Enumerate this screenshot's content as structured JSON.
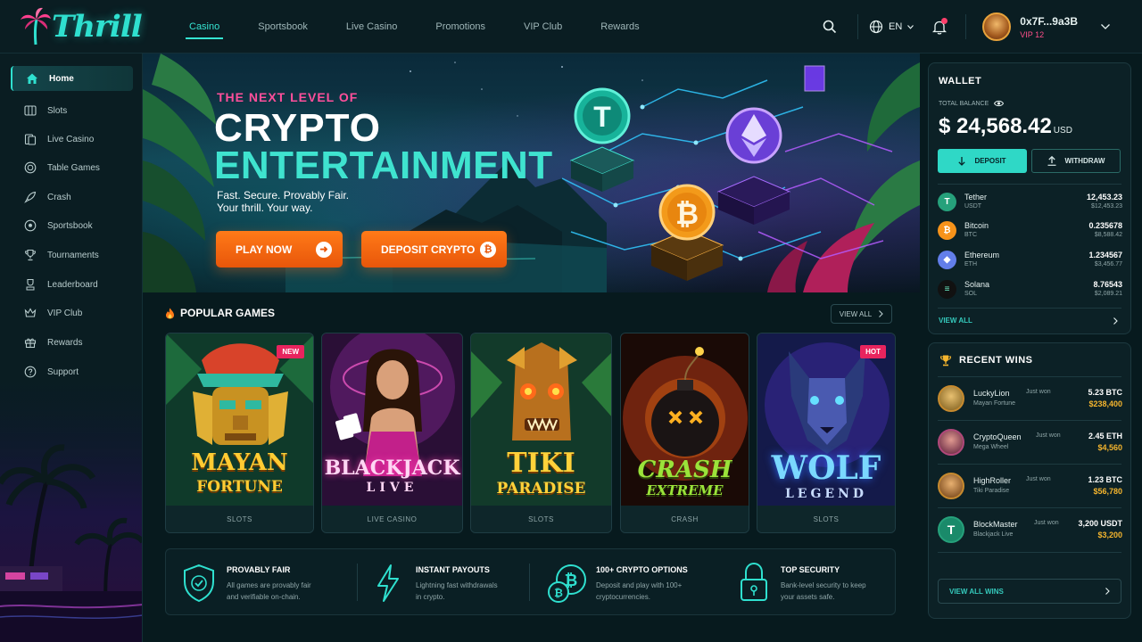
{
  "brand": {
    "name": "Thrill"
  },
  "nav": {
    "items": [
      {
        "label": "Casino",
        "active": true
      },
      {
        "label": "Sportsbook"
      },
      {
        "label": "Live Casino"
      },
      {
        "label": "Promotions"
      },
      {
        "label": "VIP Club"
      },
      {
        "label": "Rewards"
      }
    ],
    "language": "EN",
    "user": {
      "name": "0x7F...9a3B",
      "tier": "VIP 12"
    }
  },
  "sidebar": {
    "items": [
      {
        "label": "Home",
        "icon": "home-icon",
        "active": true
      },
      {
        "label": "Slots",
        "icon": "slots-icon"
      },
      {
        "label": "Live Casino",
        "icon": "live-casino-icon"
      },
      {
        "label": "Table Games",
        "icon": "table-games-icon"
      },
      {
        "label": "Crash",
        "icon": "rocket-icon"
      },
      {
        "label": "Sportsbook",
        "icon": "soccer-ball-icon"
      },
      {
        "label": "Tournaments",
        "icon": "trophy-icon"
      },
      {
        "label": "Leaderboard",
        "icon": "leaderboard-icon"
      },
      {
        "label": "VIP Club",
        "icon": "crown-icon"
      },
      {
        "label": "Rewards",
        "icon": "gift-icon"
      },
      {
        "label": "Support",
        "icon": "help-icon"
      }
    ]
  },
  "hero": {
    "kicker": "THE NEXT LEVEL OF",
    "title_line1": "CRYPTO",
    "title_line2": "ENTERTAINMENT",
    "sub_line1": "Fast. Secure. Provably Fair.",
    "sub_line2": "Your thrill. Your way.",
    "cta_primary": "PLAY NOW",
    "cta_secondary": "DEPOSIT CRYPTO"
  },
  "popular": {
    "title": "POPULAR GAMES",
    "view_all": "VIEW ALL",
    "games": [
      {
        "title": "MAYAN",
        "subtitle": "FORTUNE",
        "category": "SLOTS",
        "badge": "NEW"
      },
      {
        "title": "BLACKJACK",
        "subtitle": "LIVE",
        "category": "LIVE CASINO",
        "badge": ""
      },
      {
        "title": "TIKI",
        "subtitle": "PARADISE",
        "category": "SLOTS",
        "badge": ""
      },
      {
        "title": "CRASH",
        "subtitle": "EXTREME",
        "category": "CRASH",
        "badge": ""
      },
      {
        "title": "WOLF",
        "subtitle": "LEGEND",
        "category": "SLOTS",
        "badge": "HOT"
      }
    ]
  },
  "features": [
    {
      "title": "PROVABLY FAIR",
      "desc_line1": "All games are provably fair",
      "desc_line2": "and verifiable on-chain.",
      "icon": "shield-check-icon"
    },
    {
      "title": "INSTANT PAYOUTS",
      "desc_line1": "Lightning fast withdrawals",
      "desc_line2": "in crypto.",
      "icon": "lightning-icon"
    },
    {
      "title": "100+ CRYPTO OPTIONS",
      "desc_line1": "Deposit and play with 100+",
      "desc_line2": "cryptocurrencies.",
      "icon": "crypto-coins-icon"
    },
    {
      "title": "TOP SECURITY",
      "desc_line1": "Bank-level security to keep",
      "desc_line2": "your assets safe.",
      "icon": "padlock-icon"
    }
  ],
  "wallet": {
    "title": "WALLET",
    "total_label": "TOTAL BALANCE",
    "balance": "$ 24,568.42",
    "currency": "USD",
    "deposit": "DEPOSIT",
    "withdraw": "WITHDRAW",
    "assets": [
      {
        "name": "Tether",
        "symbol": "USDT",
        "amount": "12,453.23",
        "usd": "$12,453.23",
        "color": "#26a17b",
        "glyph": "T"
      },
      {
        "name": "Bitcoin",
        "symbol": "BTC",
        "amount": "0.235678",
        "usd": "$8,588.42",
        "color": "#f7931a",
        "glyph": "₿"
      },
      {
        "name": "Ethereum",
        "symbol": "ETH",
        "amount": "1.234567",
        "usd": "$3,456.77",
        "color": "#627eea",
        "glyph": "◆"
      },
      {
        "name": "Solana",
        "symbol": "SOL",
        "amount": "8.76543",
        "usd": "$2,089.21",
        "color": "#111111",
        "glyph": "≡"
      }
    ],
    "view_all": "VIEW ALL"
  },
  "wins": {
    "title": "RECENT WINS",
    "just_won": "Just won",
    "items": [
      {
        "user": "LuckyLion",
        "game": "Mayan Fortune",
        "amount": "5.23 BTC",
        "usd": "$238,400",
        "color": "#c78a2e"
      },
      {
        "user": "CryptoQueen",
        "game": "Mega Wheel",
        "amount": "2.45 ETH",
        "usd": "$4,560",
        "color": "#b0487a"
      },
      {
        "user": "HighRoller",
        "game": "Tiki Paradise",
        "amount": "1.23 BTC",
        "usd": "$56,780",
        "color": "#c78a2e"
      },
      {
        "user": "BlockMaster",
        "game": "Blackjack Live",
        "amount": "3,200 USDT",
        "usd": "$3,200",
        "color": "#26a17b"
      }
    ],
    "view_all": "VIEW ALL WINS"
  },
  "colors": {
    "accent": "#2fe0cf",
    "cta": "#ff7a18",
    "badge": "#e8245e",
    "gold": "#f5b52e"
  }
}
